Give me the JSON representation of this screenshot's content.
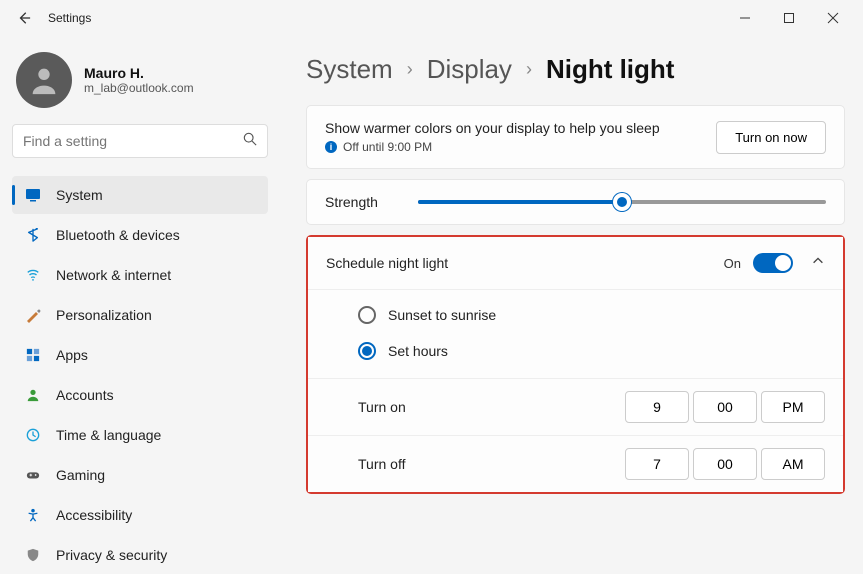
{
  "window": {
    "title": "Settings"
  },
  "profile": {
    "name": "Mauro H.",
    "email": "m_lab@outlook.com"
  },
  "search": {
    "placeholder": "Find a setting"
  },
  "nav": {
    "items": [
      {
        "label": "System"
      },
      {
        "label": "Bluetooth & devices"
      },
      {
        "label": "Network & internet"
      },
      {
        "label": "Personalization"
      },
      {
        "label": "Apps"
      },
      {
        "label": "Accounts"
      },
      {
        "label": "Time & language"
      },
      {
        "label": "Gaming"
      },
      {
        "label": "Accessibility"
      },
      {
        "label": "Privacy & security"
      }
    ]
  },
  "breadcrumb": {
    "root": "System",
    "mid": "Display",
    "current": "Night light"
  },
  "top": {
    "description": "Show warmer colors on your display to help you sleep",
    "status": "Off until 9:00 PM",
    "button": "Turn on now"
  },
  "strength": {
    "label": "Strength",
    "value_percent": 50
  },
  "schedule": {
    "label": "Schedule night light",
    "state": "On",
    "options": {
      "sunset": "Sunset to sunrise",
      "sethours": "Set hours"
    },
    "turn_on": {
      "label": "Turn on",
      "hour": "9",
      "minute": "00",
      "ampm": "PM"
    },
    "turn_off": {
      "label": "Turn off",
      "hour": "7",
      "minute": "00",
      "ampm": "AM"
    }
  }
}
